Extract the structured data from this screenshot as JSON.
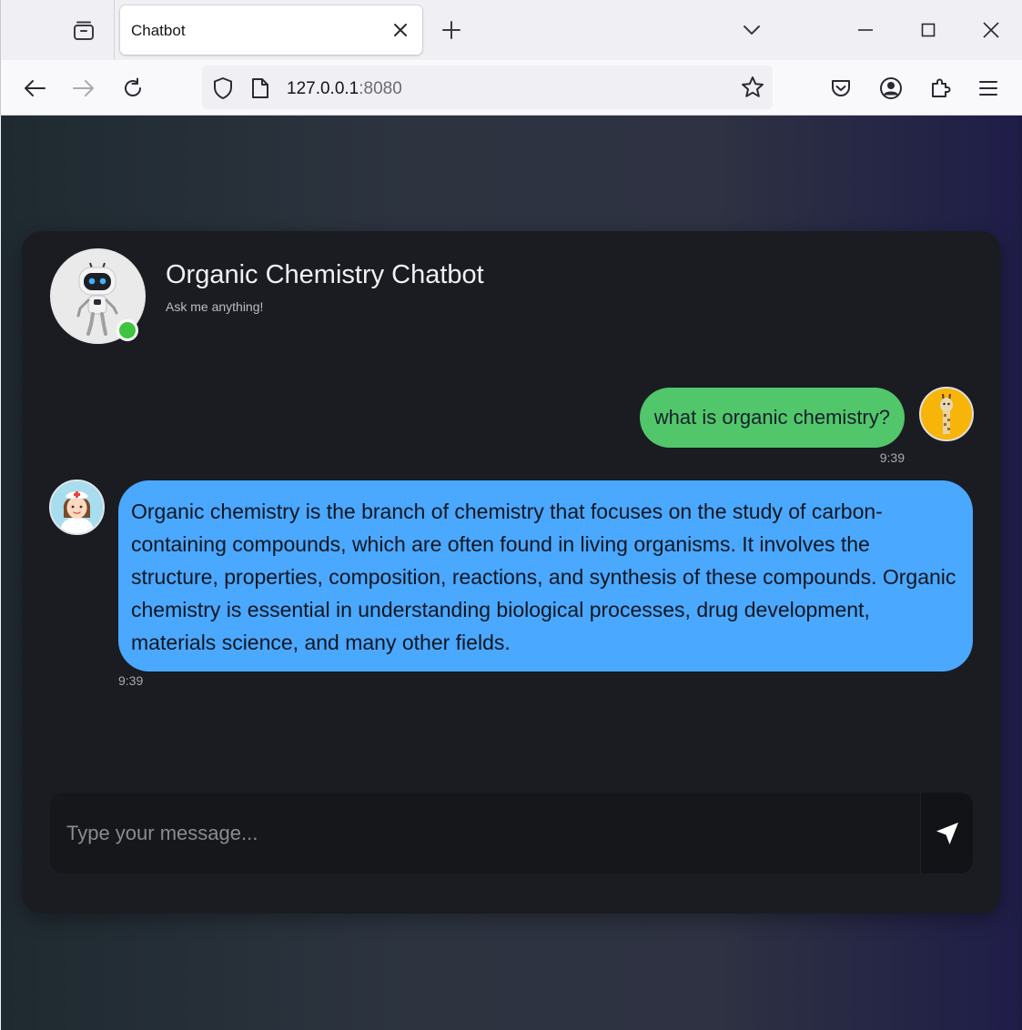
{
  "browser": {
    "tab_title": "Chatbot",
    "url_host": "127.0.0.1",
    "url_port": ":8080",
    "icons": {
      "tab_overview": "tab-overview-icon",
      "tab_close": "close-icon",
      "new_tab": "plus-icon",
      "tab_list": "chevron-down-icon",
      "minimize": "minimize-icon",
      "maximize": "maximize-icon",
      "close_window": "close-icon",
      "back": "arrow-left-icon",
      "forward": "arrow-right-icon",
      "reload": "reload-icon",
      "shield": "shield-icon",
      "page": "page-icon",
      "bookmark": "star-icon",
      "pocket": "pocket-icon",
      "account": "account-icon",
      "extensions": "puzzle-icon",
      "menu": "hamburger-icon"
    }
  },
  "chat": {
    "title": "Organic Chemistry Chatbot",
    "subtitle": "Ask me anything!",
    "status": "online",
    "messages": [
      {
        "sender": "user",
        "text": "what is organic chemistry?",
        "time": "9:39"
      },
      {
        "sender": "bot",
        "text": "Organic chemistry is the branch of chemistry that focuses on the study of carbon-containing compounds, which are often found in living organisms. It involves the structure, properties, composition, reactions, and synthesis of these compounds. Organic chemistry is essential in understanding biological processes, drug development, materials science, and many other fields.",
        "time": "9:39"
      }
    ],
    "input": {
      "placeholder": "Type your message...",
      "value": ""
    },
    "colors": {
      "user_bubble": "#52c66a",
      "bot_bubble": "#4aa8ff",
      "online": "#3ec43e",
      "card": "#1a1c22"
    }
  }
}
